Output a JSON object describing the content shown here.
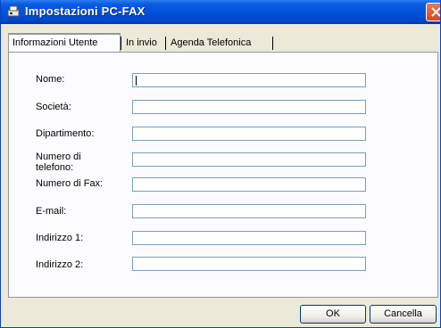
{
  "window": {
    "title": "Impostazioni PC-FAX",
    "app_icon": "fax-icon",
    "close_icon": "close-icon"
  },
  "tabs": [
    {
      "label": "Informazioni Utente",
      "active": true
    },
    {
      "label": "In invio",
      "active": false
    },
    {
      "label": "Agenda Telefonica",
      "active": false
    }
  ],
  "form": {
    "fields": [
      {
        "label": "Nome:",
        "value": ""
      },
      {
        "label": "Società:",
        "value": ""
      },
      {
        "label": "Dipartimento:",
        "value": ""
      },
      {
        "label": "Numero di telefono:",
        "value": ""
      },
      {
        "label": "Numero di Fax:",
        "value": ""
      },
      {
        "label": "E-mail:",
        "value": ""
      },
      {
        "label": "Indirizzo 1:",
        "value": ""
      },
      {
        "label": "Indirizzo 2:",
        "value": ""
      }
    ]
  },
  "buttons": {
    "ok": "OK",
    "cancel": "Cancella"
  },
  "colors": {
    "titlebar": "#0050d8",
    "close_button": "#d24820",
    "field_border": "#7f9db9",
    "dialog_bg": "#ece9d8"
  }
}
